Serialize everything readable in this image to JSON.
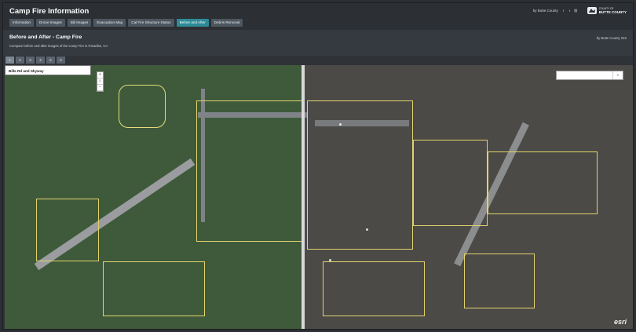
{
  "app": {
    "title": "Camp Fire Information"
  },
  "nav": [
    "Information",
    "Drone Images",
    "Bili Images",
    "Evacuation Map",
    "Cal Fire Structure Status",
    "Before and After",
    "Debris Removal"
  ],
  "top_right": {
    "credit": "by Butte County",
    "brand_title": "BUTTE COUNTY",
    "brand_sub": "COUNTY OF"
  },
  "story": {
    "title": "Before and After - Camp Fire",
    "subtitle": "Compare before and after images of the Camp Fire in Paradise, CA",
    "credit": "by Butte County GIS"
  },
  "pages": [
    "1",
    "2",
    "3",
    "4",
    "5",
    "6"
  ],
  "map": {
    "location_label": "Bille Rd and Skyway",
    "search_placeholder": "",
    "zoom_in": "+",
    "home": "⌂",
    "zoom_out": "−",
    "watermark": "esri"
  },
  "colors": {
    "active_tab": "#2d8b97",
    "header": "#2c2f34"
  }
}
